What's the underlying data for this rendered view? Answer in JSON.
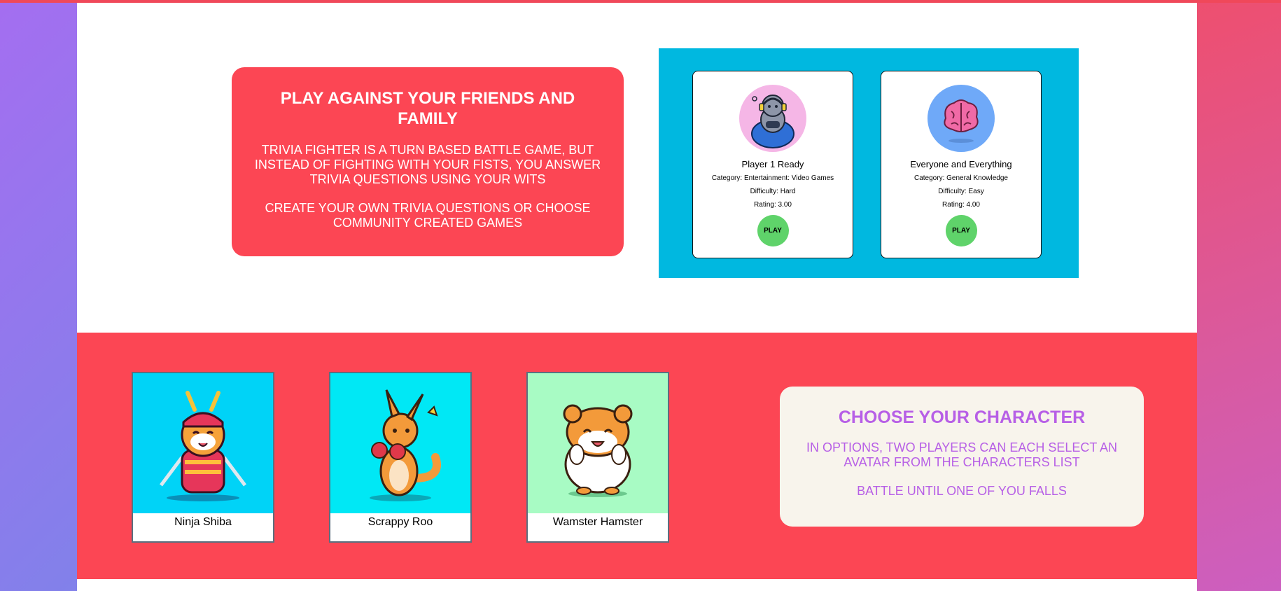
{
  "intro": {
    "heading": "PLAY AGAINST YOUR FRIENDS AND FAMILY",
    "paragraph1": "TRIVIA FIGHTER IS A TURN BASED BATTLE GAME, BUT INSTEAD OF FIGHTING WITH YOUR FISTS, YOU ANSWER TRIVIA QUESTIONS USING YOUR WITS",
    "paragraph2": "CREATE YOUR OWN TRIVIA QUESTIONS OR CHOOSE COMMUNITY CREATED GAMES"
  },
  "games": [
    {
      "title": "Player 1 Ready",
      "category": "Category: Entertainment: Video Games",
      "difficulty": "Difficulty: Hard",
      "rating": "Rating: 3.00",
      "play_label": "PLAY",
      "art_icon": "gamer-cat-icon",
      "art_bg": "#f5b6e6"
    },
    {
      "title": "Everyone and Everything",
      "category": "Category: General Knowledge",
      "difficulty": "Difficulty: Easy",
      "rating": "Rating: 4.00",
      "play_label": "PLAY",
      "art_icon": "brain-icon",
      "art_bg": "#6fa9f8"
    }
  ],
  "characters": [
    {
      "name": "Ninja Shiba",
      "bg": "#00d3f7",
      "icon": "samurai-shiba-icon"
    },
    {
      "name": "Scrappy Roo",
      "bg": "#00e8f5",
      "icon": "boxing-kangaroo-icon"
    },
    {
      "name": "Wamster Hamster",
      "bg": "#a8fbc4",
      "icon": "hamster-icon"
    }
  ],
  "choose": {
    "heading": "CHOOSE YOUR CHARACTER",
    "paragraph1": "IN OPTIONS, TWO PLAYERS CAN EACH SELECT AN AVATAR FROM THE CHARACTERS LIST",
    "paragraph2": "BATTLE UNTIL ONE OF YOU FALLS"
  },
  "colors": {
    "accent_red": "#fc4654",
    "panel_blue": "#00b8e0",
    "play_green": "#5fd36a",
    "choose_purple": "#b75fe6"
  }
}
